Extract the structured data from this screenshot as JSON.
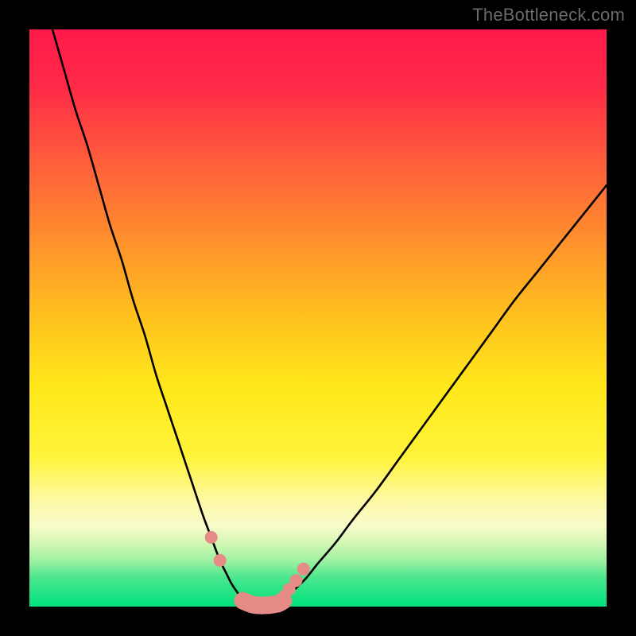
{
  "watermark": {
    "text": "TheBottleneck.com"
  },
  "gradient": {
    "stops": [
      {
        "offset": 0,
        "color": "#ff1a4b"
      },
      {
        "offset": 0.1,
        "color": "#ff2a47"
      },
      {
        "offset": 0.22,
        "color": "#ff5a3c"
      },
      {
        "offset": 0.35,
        "color": "#ff8a2e"
      },
      {
        "offset": 0.5,
        "color": "#ffc21e"
      },
      {
        "offset": 0.62,
        "color": "#ffe81a"
      },
      {
        "offset": 0.74,
        "color": "#fff43a"
      },
      {
        "offset": 0.82,
        "color": "#fdf9a8"
      },
      {
        "offset": 0.86,
        "color": "#f7fbca"
      },
      {
        "offset": 0.89,
        "color": "#d4f7b4"
      },
      {
        "offset": 0.92,
        "color": "#9ff1a3"
      },
      {
        "offset": 0.95,
        "color": "#4be68e"
      },
      {
        "offset": 1.0,
        "color": "#00e27e"
      }
    ]
  },
  "chart_data": {
    "type": "line",
    "title": "",
    "xlabel": "",
    "ylabel": "",
    "xlim": [
      0,
      100
    ],
    "ylim": [
      0,
      100
    ],
    "grid": false,
    "note": "Bottleneck-style V curve; y≈100 at edges → 0 at valley. Values read from pixel positions (approx).",
    "series": [
      {
        "name": "left-branch",
        "x": [
          4,
          6,
          8,
          10,
          12,
          14,
          16,
          18,
          20,
          22,
          24,
          26,
          28,
          30,
          31.5,
          33,
          34,
          35,
          36,
          37
        ],
        "y": [
          100,
          93,
          86,
          80,
          73,
          66,
          60,
          53,
          47,
          40,
          34,
          28,
          22,
          16,
          12,
          8,
          6,
          4,
          2.5,
          1
        ]
      },
      {
        "name": "right-branch",
        "x": [
          44,
          45,
          46,
          48,
          50,
          53,
          56,
          60,
          64,
          68,
          72,
          76,
          80,
          84,
          88,
          92,
          96,
          100
        ],
        "y": [
          1,
          2,
          3,
          5,
          7.5,
          11,
          15,
          20,
          25.5,
          31,
          36.5,
          42,
          47.5,
          53,
          58,
          63,
          68,
          73
        ]
      },
      {
        "name": "valley-floor",
        "x": [
          37,
          38.5,
          40,
          41.5,
          43,
          44
        ],
        "y": [
          1,
          0.4,
          0.2,
          0.25,
          0.5,
          1
        ]
      }
    ],
    "markers": [
      {
        "name": "left-upper",
        "x": 31.5,
        "y": 12
      },
      {
        "name": "left-lower",
        "x": 33.0,
        "y": 8
      },
      {
        "name": "valley-left",
        "x": 37.0,
        "y": 1
      },
      {
        "name": "valley-mid1",
        "x": 38.5,
        "y": 0.4
      },
      {
        "name": "valley-mid2",
        "x": 40.0,
        "y": 0.2
      },
      {
        "name": "valley-mid3",
        "x": 41.5,
        "y": 0.25
      },
      {
        "name": "valley-right",
        "x": 43.0,
        "y": 0.5
      },
      {
        "name": "right-enter",
        "x": 44.2,
        "y": 1.8
      },
      {
        "name": "right-lower",
        "x": 45.0,
        "y": 3
      },
      {
        "name": "right-mid",
        "x": 46.2,
        "y": 4.5
      },
      {
        "name": "right-upper",
        "x": 47.5,
        "y": 6.5
      }
    ],
    "marker_style": {
      "fill": "#e78b86",
      "r_small": 8,
      "r_cap": 11
    }
  }
}
